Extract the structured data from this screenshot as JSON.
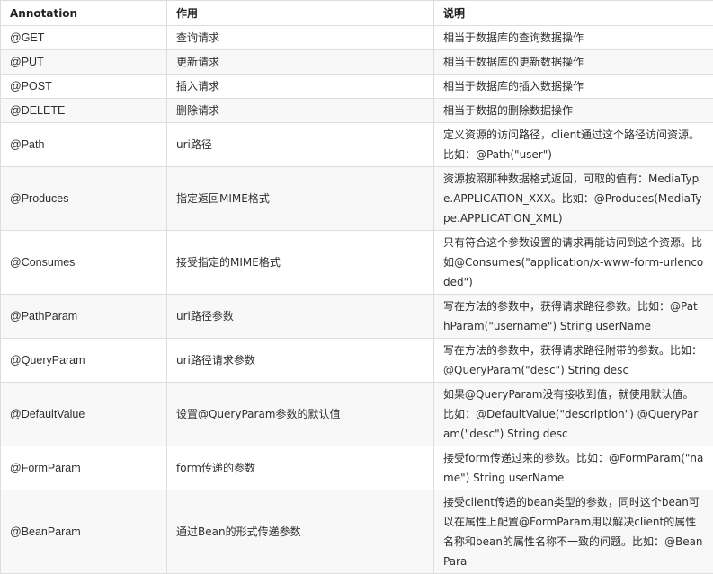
{
  "headers": {
    "annotation": "Annotation",
    "purpose": "作用",
    "description": "说明"
  },
  "rows": [
    {
      "annotation": "@GET",
      "purpose": "查询请求",
      "description": "相当于数据库的查询数据操作"
    },
    {
      "annotation": "@PUT",
      "purpose": "更新请求",
      "description": "相当于数据库的更新数据操作"
    },
    {
      "annotation": "@POST",
      "purpose": "插入请求",
      "description": "相当于数据库的插入数据操作"
    },
    {
      "annotation": "@DELETE",
      "purpose": "删除请求",
      "description": "相当于数据的删除数据操作"
    },
    {
      "annotation": "@Path",
      "purpose": "uri路径",
      "description": "定义资源的访问路径，client通过这个路径访问资源。比如：@Path(\"user\")"
    },
    {
      "annotation": "@Produces",
      "purpose": "指定返回MIME格式",
      "description": "资源按照那种数据格式返回，可取的值有：MediaType.APPLICATION_XXX。比如：@Produces(MediaType.APPLICATION_XML)"
    },
    {
      "annotation": "@Consumes",
      "purpose": "接受指定的MIME格式",
      "description": "只有符合这个参数设置的请求再能访问到这个资源。比如@Consumes(\"application/x-www-form-urlencoded\")"
    },
    {
      "annotation": "@PathParam",
      "purpose": "uri路径参数",
      "description": "写在方法的参数中，获得请求路径参数。比如：@PathParam(\"username\") String userName"
    },
    {
      "annotation": "@QueryParam",
      "purpose": "uri路径请求参数",
      "description": "写在方法的参数中，获得请求路径附带的参数。比如：@QueryParam(\"desc\") String desc"
    },
    {
      "annotation": "@DefaultValue",
      "purpose": "设置@QueryParam参数的默认值",
      "description": "如果@QueryParam没有接收到值，就使用默认值。比如：@DefaultValue(\"description\") @QueryParam(\"desc\") String desc"
    },
    {
      "annotation": "@FormParam",
      "purpose": "form传递的参数",
      "description": "接受form传递过来的参数。比如：@FormParam(\"name\") String userName"
    },
    {
      "annotation": "@BeanParam",
      "purpose": "通过Bean的形式传递参数",
      "description": "接受client传递的bean类型的参数，同时这个bean可以在属性上配置@FormParam用以解决client的属性名称和bean的属性名称不一致的问题。比如：@BeanPara"
    }
  ]
}
